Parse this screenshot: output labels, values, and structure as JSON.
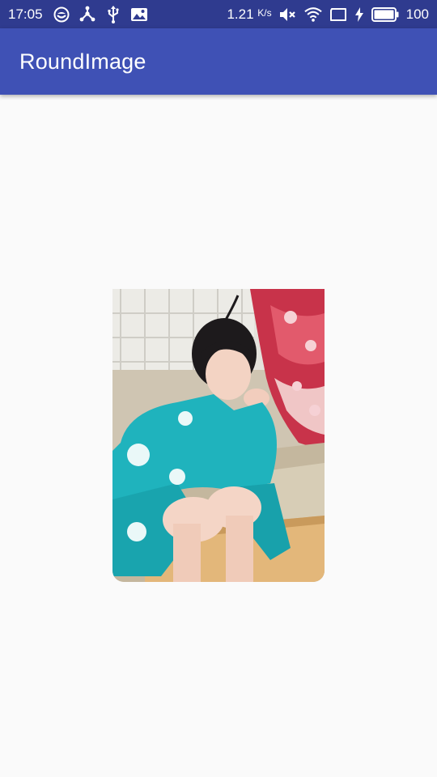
{
  "status_bar": {
    "time": "17:05",
    "network_speed": "1.21",
    "network_speed_unit": "K/s",
    "battery_percent": "100",
    "icons": [
      "sync-icon",
      "share-hub-icon",
      "usb-icon",
      "gallery-icon",
      "mute-icon",
      "wifi-icon",
      "screen-icon",
      "charging-icon",
      "battery-icon"
    ]
  },
  "app_bar": {
    "title": "RoundImage"
  },
  "colors": {
    "status_bar": "#2f3b8f",
    "primary": "#3f51b5",
    "background": "#fafafa"
  },
  "main": {
    "image": {
      "description_icon": "photo-image",
      "corners": "rounded-bottom"
    }
  }
}
